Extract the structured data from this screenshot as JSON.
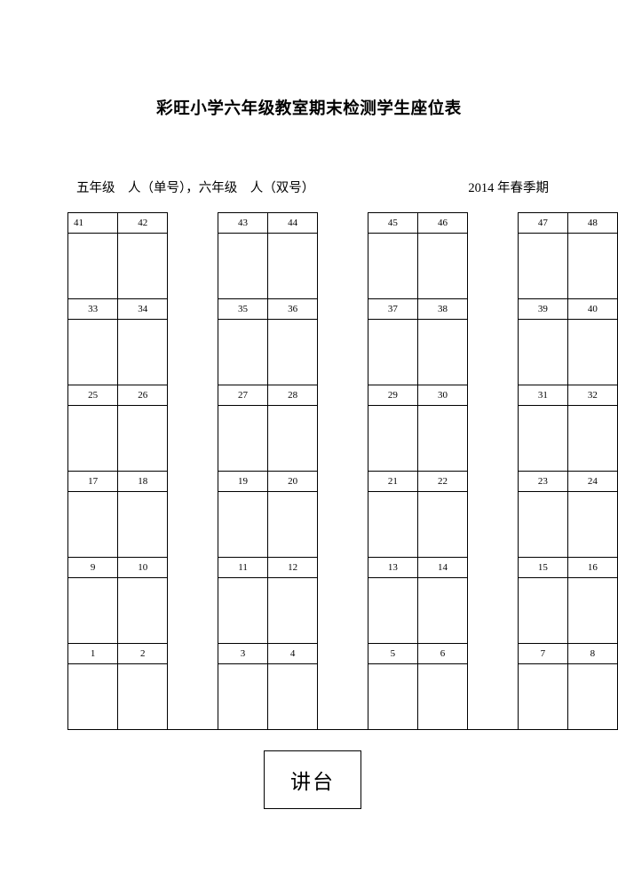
{
  "document": {
    "title": "彩旺小学六年级教室期末检测学生座位表",
    "subtitle_left": "五年级　人（单号），六年级　人（双号）",
    "subtitle_right": "2014 年春季期",
    "podium_label": "讲台"
  },
  "seating": {
    "group_count": 4,
    "columns_per_group": 2,
    "row_count": 6,
    "first_cell_left_aligned": true,
    "rows": [
      {
        "cells": [
          "41",
          "42",
          "43",
          "44",
          "45",
          "46",
          "47",
          "48"
        ]
      },
      {
        "cells": [
          "33",
          "34",
          "35",
          "36",
          "37",
          "38",
          "39",
          "40"
        ]
      },
      {
        "cells": [
          "25",
          "26",
          "27",
          "28",
          "29",
          "30",
          "31",
          "32"
        ]
      },
      {
        "cells": [
          "17",
          "18",
          "19",
          "20",
          "21",
          "22",
          "23",
          "24"
        ]
      },
      {
        "cells": [
          "9",
          "10",
          "11",
          "12",
          "13",
          "14",
          "15",
          "16"
        ]
      },
      {
        "cells": [
          "1",
          "2",
          "3",
          "4",
          "5",
          "6",
          "7",
          "8"
        ]
      }
    ]
  },
  "colors": {
    "ink": "#000000",
    "paper": "#ffffff",
    "rule": "#000000"
  }
}
